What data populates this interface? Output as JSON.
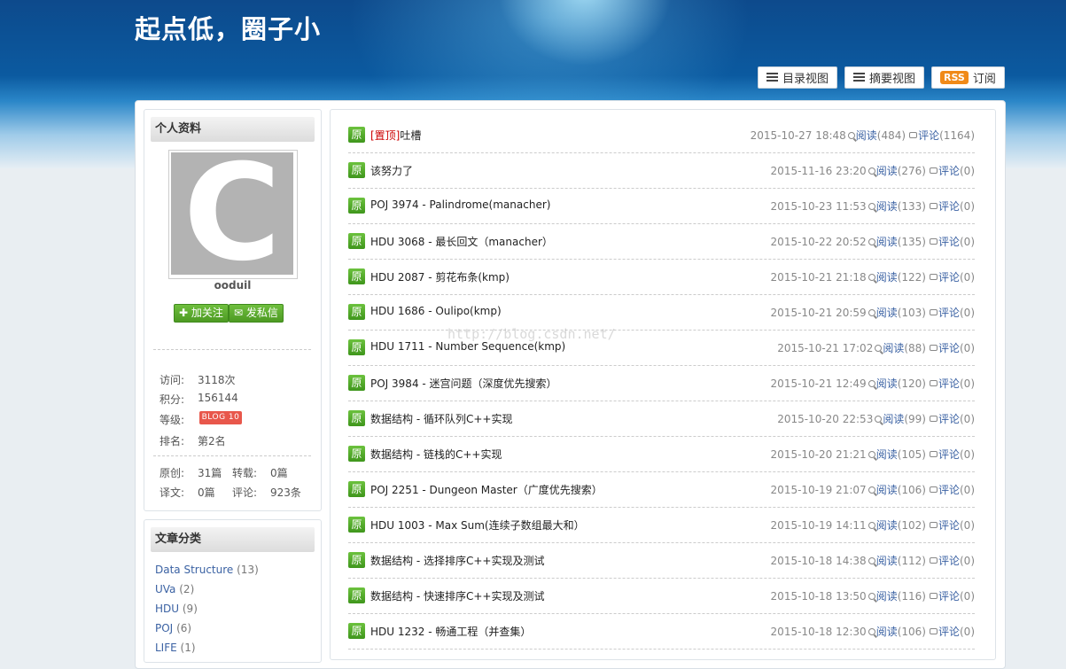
{
  "blog": {
    "title": "起点低，圈子小"
  },
  "views": {
    "catalog_label": "目录视图",
    "summary_label": "摘要视图",
    "rss_badge": "RSS",
    "subscribe_label": "订阅"
  },
  "profile": {
    "heading": "个人资料",
    "avatar_letter": "C",
    "username": "ooduil",
    "follow_label": "加关注",
    "message_label": "发私信",
    "stats": {
      "visits_label": "访问:",
      "visits": "3118次",
      "points_label": "积分:",
      "points": "156144",
      "level_label": "等级:",
      "level_badge": "BLOG 10",
      "rank_label": "排名:",
      "rank": "第2名",
      "original_label": "原创:",
      "original": "31篇",
      "repost_label": "转载:",
      "repost": "0篇",
      "translated_label": "译文:",
      "translated": "0篇",
      "comments_label": "评论:",
      "comments": "923条"
    }
  },
  "categories": {
    "heading": "文章分类",
    "items": [
      {
        "name": "Data Structure",
        "count": "(13)"
      },
      {
        "name": "UVa",
        "count": "(2)"
      },
      {
        "name": "HDU",
        "count": "(9)"
      },
      {
        "name": "POJ",
        "count": "(6)"
      },
      {
        "name": "LIFE",
        "count": "(1)"
      }
    ]
  },
  "watermark": "http://blog.csdn.net/",
  "articles": [
    {
      "tag": "原",
      "top": "[置顶]",
      "title": "吐槽",
      "date": "2015-10-27 18:48",
      "read_label": "阅读",
      "reads": "(484)",
      "comment_label": "评论",
      "comments": "(1164)"
    },
    {
      "tag": "原",
      "top": "",
      "title": "该努力了",
      "date": "2015-11-16 23:20",
      "read_label": "阅读",
      "reads": "(276)",
      "comment_label": "评论",
      "comments": "(0)"
    },
    {
      "tag": "原",
      "top": "",
      "title": "POJ 3974 - Palindrome(manacher)",
      "date": "2015-10-23 11:53",
      "read_label": "阅读",
      "reads": "(133)",
      "comment_label": "评论",
      "comments": "(0)"
    },
    {
      "tag": "原",
      "top": "",
      "title": "HDU 3068 - 最长回文（manacher）",
      "date": "2015-10-22 20:52",
      "read_label": "阅读",
      "reads": "(135)",
      "comment_label": "评论",
      "comments": "(0)"
    },
    {
      "tag": "原",
      "top": "",
      "title": "HDU 2087 - 剪花布条(kmp)",
      "date": "2015-10-21 21:18",
      "read_label": "阅读",
      "reads": "(122)",
      "comment_label": "评论",
      "comments": "(0)"
    },
    {
      "tag": "原",
      "top": "",
      "title": "HDU 1686 - Oulipo(kmp)",
      "date": "2015-10-21 20:59",
      "read_label": "阅读",
      "reads": "(103)",
      "comment_label": "评论",
      "comments": "(0)"
    },
    {
      "tag": "原",
      "top": "",
      "title": "HDU 1711 - Number Sequence(kmp)",
      "date": "2015-10-21 17:02",
      "read_label": "阅读",
      "reads": "(88)",
      "comment_label": "评论",
      "comments": "(0)"
    },
    {
      "tag": "原",
      "top": "",
      "title": "POJ 3984 - 迷宫问题（深度优先搜索）",
      "date": "2015-10-21 12:49",
      "read_label": "阅读",
      "reads": "(120)",
      "comment_label": "评论",
      "comments": "(0)"
    },
    {
      "tag": "原",
      "top": "",
      "title": "数据结构 - 循环队列C++实现",
      "date": "2015-10-20 22:53",
      "read_label": "阅读",
      "reads": "(99)",
      "comment_label": "评论",
      "comments": "(0)"
    },
    {
      "tag": "原",
      "top": "",
      "title": "数据结构 - 链栈的C++实现",
      "date": "2015-10-20 21:21",
      "read_label": "阅读",
      "reads": "(105)",
      "comment_label": "评论",
      "comments": "(0)"
    },
    {
      "tag": "原",
      "top": "",
      "title": "POJ 2251 - Dungeon Master（广度优先搜索）",
      "date": "2015-10-19 21:07",
      "read_label": "阅读",
      "reads": "(106)",
      "comment_label": "评论",
      "comments": "(0)"
    },
    {
      "tag": "原",
      "top": "",
      "title": "HDU 1003 - Max Sum(连续子数组最大和）",
      "date": "2015-10-19 14:11",
      "read_label": "阅读",
      "reads": "(102)",
      "comment_label": "评论",
      "comments": "(0)"
    },
    {
      "tag": "原",
      "top": "",
      "title": "数据结构 - 选择排序C++实现及测试",
      "date": "2015-10-18 14:38",
      "read_label": "阅读",
      "reads": "(112)",
      "comment_label": "评论",
      "comments": "(0)"
    },
    {
      "tag": "原",
      "top": "",
      "title": "数据结构 - 快速排序C++实现及测试",
      "date": "2015-10-18 13:50",
      "read_label": "阅读",
      "reads": "(116)",
      "comment_label": "评论",
      "comments": "(0)"
    },
    {
      "tag": "原",
      "top": "",
      "title": "HDU 1232 - 畅通工程（并查集）",
      "date": "2015-10-18 12:30",
      "read_label": "阅读",
      "reads": "(106)",
      "comment_label": "评论",
      "comments": "(0)"
    }
  ]
}
